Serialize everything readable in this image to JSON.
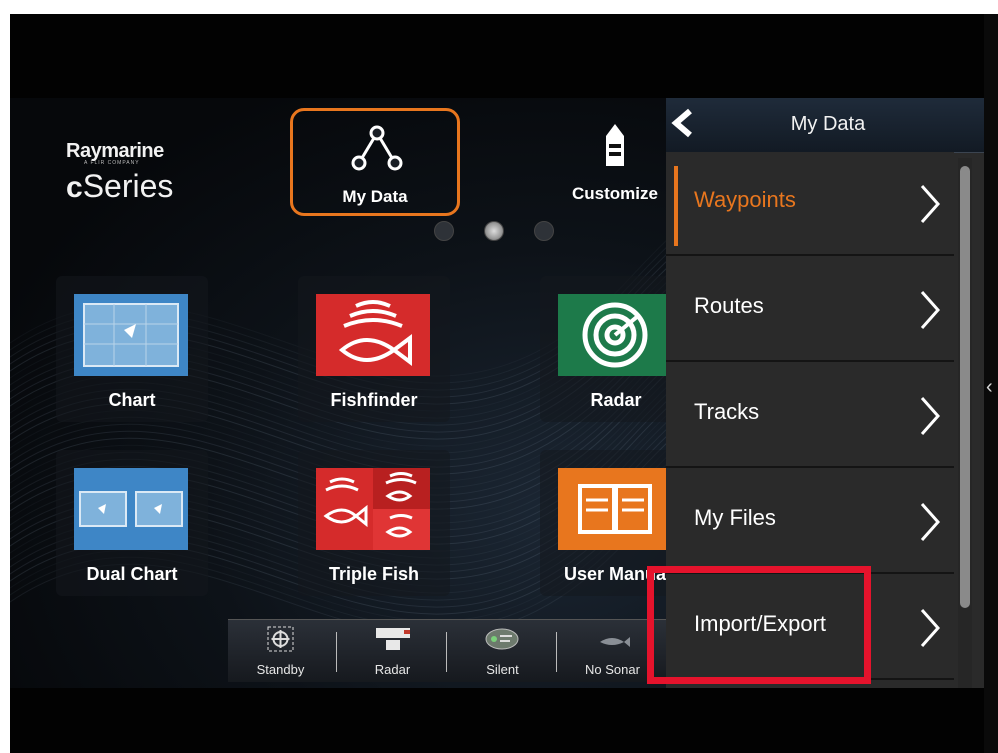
{
  "brand": {
    "name": "Raymarine",
    "subtitle": "A FLIR COMPANY",
    "series_prefix": "c",
    "series": "Series"
  },
  "top_tiles": [
    {
      "label": "My Data",
      "icon": "route-nodes-icon",
      "selected": true
    },
    {
      "label": "Customize",
      "icon": "boat-icon",
      "selected": false
    }
  ],
  "page_dots": {
    "count": 3,
    "active": 2
  },
  "apps": [
    {
      "label": "Chart",
      "icon": "chart-icon"
    },
    {
      "label": "Fishfinder",
      "icon": "fishfinder-icon"
    },
    {
      "label": "Radar",
      "icon": "radar-icon"
    },
    {
      "label": "Dual Chart",
      "icon": "dual-chart-icon"
    },
    {
      "label": "Triple Fish",
      "icon": "triple-fish-icon"
    },
    {
      "label": "User Manual",
      "icon": "book-icon"
    }
  ],
  "status_bar": [
    {
      "label": "Standby",
      "icon": "autopilot-icon"
    },
    {
      "label": "Radar",
      "icon": "radar-dome-icon"
    },
    {
      "label": "Silent",
      "icon": "ais-silent-icon"
    },
    {
      "label": "No Sonar",
      "icon": "sonar-fish-icon"
    }
  ],
  "menu": {
    "title": "My Data",
    "items": [
      {
        "label": "Waypoints",
        "selected": true
      },
      {
        "label": "Routes",
        "selected": false
      },
      {
        "label": "Tracks",
        "selected": false
      },
      {
        "label": "My Files",
        "selected": false
      },
      {
        "label": "Import/Export",
        "selected": false
      }
    ],
    "scroll_fraction_visible": 0.83
  },
  "colors": {
    "accent": "#e8761e",
    "highlight_box": "#e5132c",
    "menu_bg": "#2a2a2a",
    "header_bg": "#1a2430"
  }
}
